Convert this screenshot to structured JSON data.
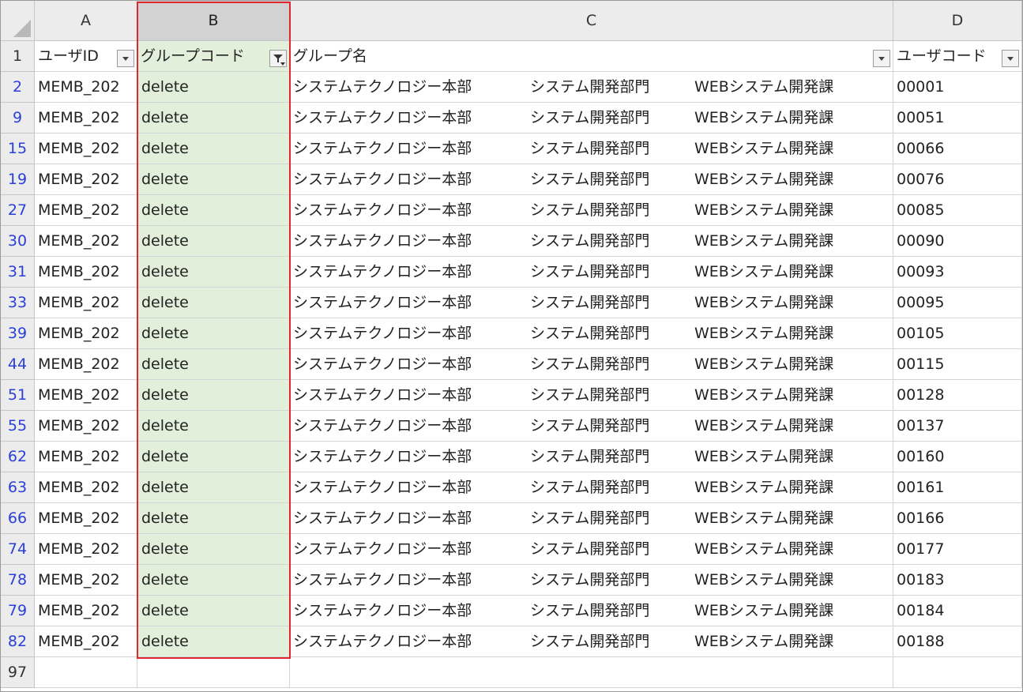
{
  "columns": [
    {
      "id": "A",
      "label": "A"
    },
    {
      "id": "B",
      "label": "B"
    },
    {
      "id": "C",
      "label": "C"
    },
    {
      "id": "D",
      "label": "D"
    }
  ],
  "header_row": {
    "row_number": "1",
    "a": "ユーザID",
    "b": "グループコード",
    "c": "グループ名",
    "d": "ユーザコード"
  },
  "rows": [
    {
      "row_number": "2",
      "a": "MEMB_202",
      "b": "delete",
      "c1": "システムテクノロジー本部",
      "c2": "システム開発部門",
      "c3": "WEBシステム開発課",
      "d": "00001"
    },
    {
      "row_number": "9",
      "a": "MEMB_202",
      "b": "delete",
      "c1": "システムテクノロジー本部",
      "c2": "システム開発部門",
      "c3": "WEBシステム開発課",
      "d": "00051"
    },
    {
      "row_number": "15",
      "a": "MEMB_202",
      "b": "delete",
      "c1": "システムテクノロジー本部",
      "c2": "システム開発部門",
      "c3": "WEBシステム開発課",
      "d": "00066"
    },
    {
      "row_number": "19",
      "a": "MEMB_202",
      "b": "delete",
      "c1": "システムテクノロジー本部",
      "c2": "システム開発部門",
      "c3": "WEBシステム開発課",
      "d": "00076"
    },
    {
      "row_number": "27",
      "a": "MEMB_202",
      "b": "delete",
      "c1": "システムテクノロジー本部",
      "c2": "システム開発部門",
      "c3": "WEBシステム開発課",
      "d": "00085"
    },
    {
      "row_number": "30",
      "a": "MEMB_202",
      "b": "delete",
      "c1": "システムテクノロジー本部",
      "c2": "システム開発部門",
      "c3": "WEBシステム開発課",
      "d": "00090"
    },
    {
      "row_number": "31",
      "a": "MEMB_202",
      "b": "delete",
      "c1": "システムテクノロジー本部",
      "c2": "システム開発部門",
      "c3": "WEBシステム開発課",
      "d": "00093"
    },
    {
      "row_number": "33",
      "a": "MEMB_202",
      "b": "delete",
      "c1": "システムテクノロジー本部",
      "c2": "システム開発部門",
      "c3": "WEBシステム開発課",
      "d": "00095"
    },
    {
      "row_number": "39",
      "a": "MEMB_202",
      "b": "delete",
      "c1": "システムテクノロジー本部",
      "c2": "システム開発部門",
      "c3": "WEBシステム開発課",
      "d": "00105"
    },
    {
      "row_number": "44",
      "a": "MEMB_202",
      "b": "delete",
      "c1": "システムテクノロジー本部",
      "c2": "システム開発部門",
      "c3": "WEBシステム開発課",
      "d": "00115"
    },
    {
      "row_number": "51",
      "a": "MEMB_202",
      "b": "delete",
      "c1": "システムテクノロジー本部",
      "c2": "システム開発部門",
      "c3": "WEBシステム開発課",
      "d": "00128"
    },
    {
      "row_number": "55",
      "a": "MEMB_202",
      "b": "delete",
      "c1": "システムテクノロジー本部",
      "c2": "システム開発部門",
      "c3": "WEBシステム開発課",
      "d": "00137"
    },
    {
      "row_number": "62",
      "a": "MEMB_202",
      "b": "delete",
      "c1": "システムテクノロジー本部",
      "c2": "システム開発部門",
      "c3": "WEBシステム開発課",
      "d": "00160"
    },
    {
      "row_number": "63",
      "a": "MEMB_202",
      "b": "delete",
      "c1": "システムテクノロジー本部",
      "c2": "システム開発部門",
      "c3": "WEBシステム開発課",
      "d": "00161"
    },
    {
      "row_number": "66",
      "a": "MEMB_202",
      "b": "delete",
      "c1": "システムテクノロジー本部",
      "c2": "システム開発部門",
      "c3": "WEBシステム開発課",
      "d": "00166"
    },
    {
      "row_number": "74",
      "a": "MEMB_202",
      "b": "delete",
      "c1": "システムテクノロジー本部",
      "c2": "システム開発部門",
      "c3": "WEBシステム開発課",
      "d": "00177"
    },
    {
      "row_number": "78",
      "a": "MEMB_202",
      "b": "delete",
      "c1": "システムテクノロジー本部",
      "c2": "システム開発部門",
      "c3": "WEBシステム開発課",
      "d": "00183"
    },
    {
      "row_number": "79",
      "a": "MEMB_202",
      "b": "delete",
      "c1": "システムテクノロジー本部",
      "c2": "システム開発部門",
      "c3": "WEBシステム開発課",
      "d": "00184"
    },
    {
      "row_number": "82",
      "a": "MEMB_202",
      "b": "delete",
      "c1": "システムテクノロジー本部",
      "c2": "システム開発部門",
      "c3": "WEBシステム開発課",
      "d": "00188"
    }
  ],
  "trailing_row": {
    "row_number": "97"
  },
  "filter_icons": {
    "a": "filter-dropdown-icon",
    "b": "filter-active-icon",
    "c": "filter-dropdown-icon",
    "d": "filter-dropdown-icon"
  },
  "colors": {
    "selected_column_fill": "#e2efda",
    "selection_border": "#e0262e",
    "filtered_row_number": "#2a3fd8",
    "header_fill": "#ececec"
  },
  "selected_column": "B"
}
